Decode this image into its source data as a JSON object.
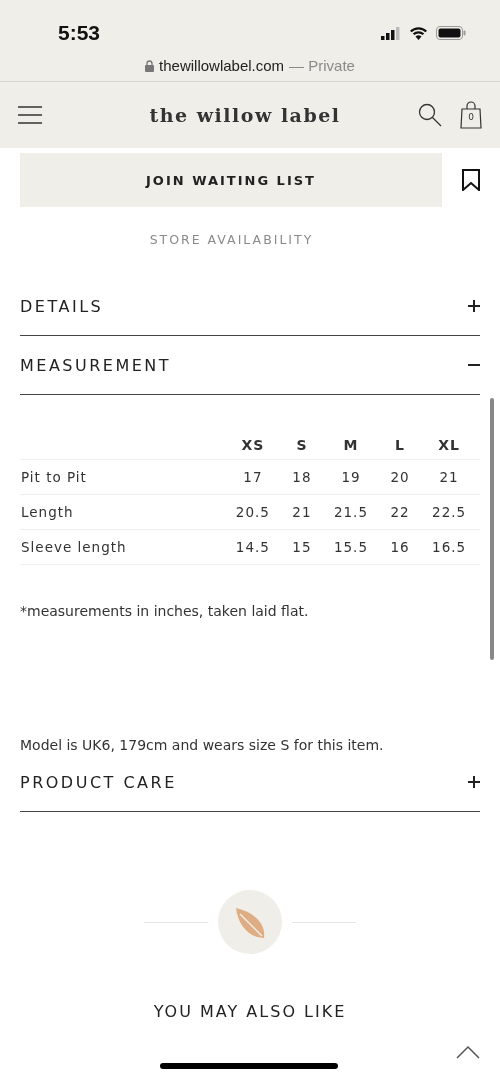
{
  "status_bar": {
    "time": "5:53"
  },
  "browser": {
    "url": "thewillowlabel.com",
    "mode": "— Private"
  },
  "header": {
    "logo": "the willow label",
    "cart_count": "0"
  },
  "waiting_list_button": "JOIN WAITING LIST",
  "store_availability": "STORE AVAILABILITY",
  "sections": [
    {
      "title": "DETAILS",
      "expanded": false
    },
    {
      "title": "MEASUREMENT",
      "expanded": true,
      "table": {
        "columns": [
          "XS",
          "S",
          "M",
          "L",
          "XL"
        ],
        "rows": [
          {
            "label": "Pit to Pit",
            "values": [
              "17",
              "18",
              "19",
              "20",
              "21"
            ]
          },
          {
            "label": "Length",
            "values": [
              "20.5",
              "21",
              "21.5",
              "22",
              "22.5"
            ]
          },
          {
            "label": "Sleeve length",
            "values": [
              "14.5",
              "15",
              "15.5",
              "16",
              "16.5"
            ]
          }
        ]
      },
      "notes": [
        "*measurements in inches, taken laid flat.",
        "Model is UK6, 179cm and wears size S for this item."
      ]
    },
    {
      "title": "PRODUCT CARE",
      "expanded": false
    }
  ],
  "related_heading": "YOU MAY ALSO LIKE"
}
